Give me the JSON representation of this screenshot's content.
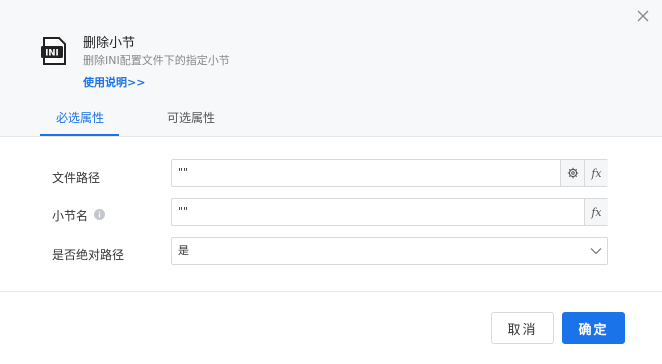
{
  "dialog": {
    "title": "删除小节",
    "subtitle": "删除INI配置文件下的指定小节",
    "help_link": "使用说明>>",
    "icon_text": "INI"
  },
  "tabs": [
    {
      "label": "必选属性",
      "active": true
    },
    {
      "label": "可选属性",
      "active": false
    }
  ],
  "fields": {
    "file_path": {
      "label": "文件路径",
      "value": "\"\""
    },
    "section_name": {
      "label": "小节名",
      "value": "\"\""
    },
    "absolute_path": {
      "label": "是否绝对路径",
      "value": "是"
    }
  },
  "buttons": {
    "cancel": "取消",
    "ok": "确定"
  },
  "colors": {
    "accent": "#1a73e8",
    "header_bg": "#f7f8fa"
  }
}
